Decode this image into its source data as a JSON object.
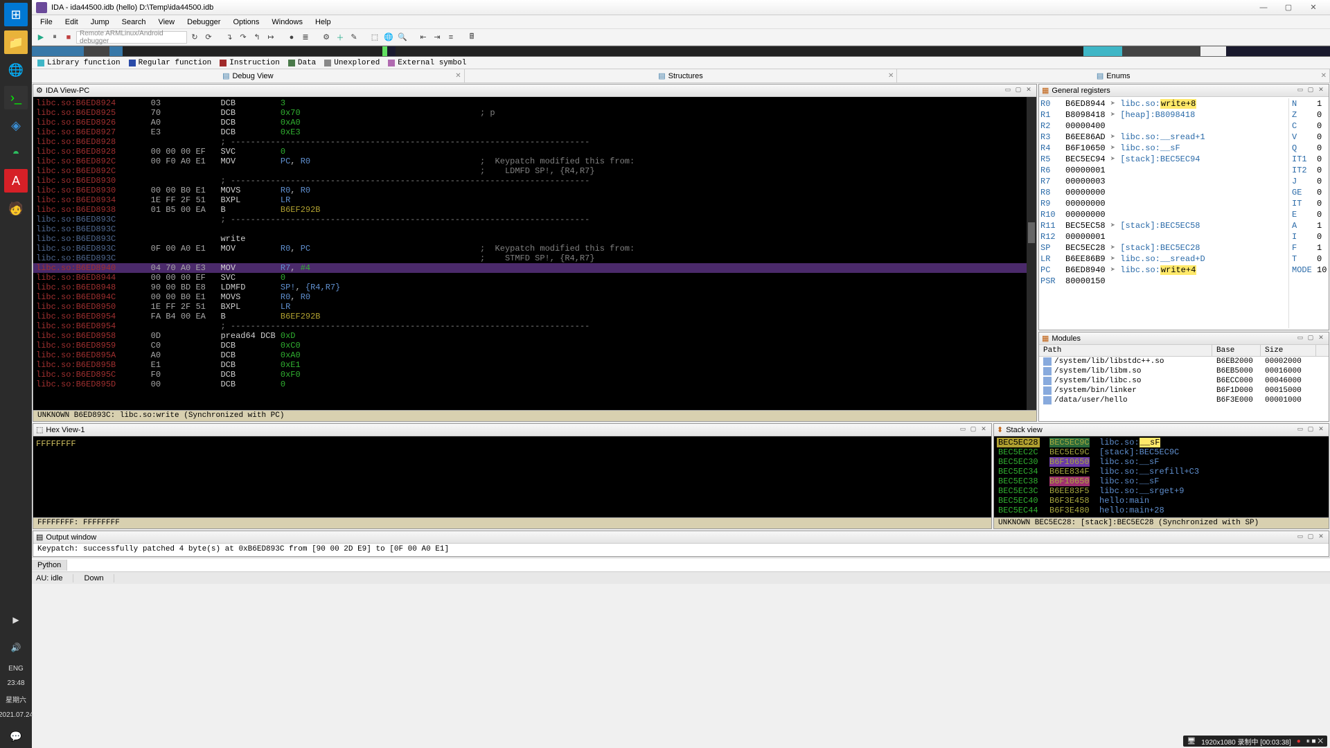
{
  "taskbar": {
    "lang": "ENG",
    "time": "23:48",
    "day": "星期六",
    "date": "2021.07.24"
  },
  "window": {
    "title": "IDA - ida44500.idb (hello)  D:\\Temp\\ida44500.idb"
  },
  "menu": [
    "File",
    "Edit",
    "Jump",
    "Search",
    "View",
    "Debugger",
    "Options",
    "Windows",
    "Help"
  ],
  "debugger_selector": "Remote ARMLinux/Android debugger",
  "legend": [
    {
      "color": "#3fb6c6",
      "label": "Library function"
    },
    {
      "color": "#2a4ba8",
      "label": "Regular function"
    },
    {
      "color": "#a02a2a",
      "label": "Instruction"
    },
    {
      "color": "#4a7a4a",
      "label": "Data"
    },
    {
      "color": "#888",
      "label": "Unexplored"
    },
    {
      "color": "#b06ab0",
      "label": "External symbol"
    }
  ],
  "top_tabs": [
    {
      "label": "Debug View",
      "closable": true
    },
    {
      "label": "Structures",
      "closable": true
    },
    {
      "label": "Enums",
      "closable": true
    }
  ],
  "panels": {
    "ida_view_title": "IDA View-PC",
    "regs_title": "General registers",
    "modules_title": "Modules",
    "hex_title": "Hex View-1",
    "stack_title": "Stack view",
    "output_title": "Output window"
  },
  "disasm": [
    {
      "loc": "libc.so:B6ED8924",
      "hex": "03",
      "mnem": "DCB",
      "ops": [
        {
          "t": "num",
          "v": "3"
        }
      ]
    },
    {
      "loc": "libc.so:B6ED8925",
      "hex": "70",
      "mnem": "DCB",
      "ops": [
        {
          "t": "num",
          "v": "0x70"
        }
      ],
      "cmt": "; p"
    },
    {
      "loc": "libc.so:B6ED8926",
      "hex": "A0",
      "mnem": "DCB",
      "ops": [
        {
          "t": "num",
          "v": "0xA0"
        }
      ]
    },
    {
      "loc": "libc.so:B6ED8927",
      "hex": "E3",
      "mnem": "DCB",
      "ops": [
        {
          "t": "num",
          "v": "0xE3"
        }
      ]
    },
    {
      "loc": "libc.so:B6ED8928",
      "hex": "",
      "mnem": ";",
      "dash": true
    },
    {
      "loc": "libc.so:B6ED8928",
      "hex": "00 00 00 EF",
      "mnem": "SVC",
      "ops": [
        {
          "t": "num",
          "v": "0"
        }
      ]
    },
    {
      "loc": "libc.so:B6ED892C",
      "hex": "00 F0 A0 E1",
      "mnem": "MOV",
      "ops": [
        {
          "t": "reg",
          "v": "PC"
        },
        {
          "t": "reg",
          "v": "R0"
        }
      ],
      "cmt": ";  Keypatch modified this from:"
    },
    {
      "loc": "libc.so:B6ED892C",
      "hex": "",
      "mnem": "",
      "cmt": ";    LDMFD SP!, {R4,R7}"
    },
    {
      "loc": "libc.so:B6ED8930",
      "hex": "",
      "mnem": ";",
      "dash": true
    },
    {
      "loc": "libc.so:B6ED8930",
      "hex": "00 00 B0 E1",
      "mnem": "MOVS",
      "ops": [
        {
          "t": "reg",
          "v": "R0"
        },
        {
          "t": "reg",
          "v": "R0"
        }
      ]
    },
    {
      "loc": "libc.so:B6ED8934",
      "hex": "1E FF 2F 51",
      "mnem": "BXPL",
      "ops": [
        {
          "t": "reg",
          "v": "LR"
        }
      ]
    },
    {
      "loc": "libc.so:B6ED8938",
      "hex": "01 B5 00 EA",
      "mnem": "B",
      "ops": [
        {
          "t": "addr",
          "v": "B6EF292B"
        }
      ]
    },
    {
      "loc": "libc.so:B6ED893C",
      "blue": true,
      "hex": "",
      "mnem": ";",
      "dash": true
    },
    {
      "loc": "libc.so:B6ED893C",
      "blue": true,
      "hex": "",
      "mnem": ""
    },
    {
      "loc": "libc.so:B6ED893C",
      "blue": true,
      "hex": "",
      "mnem": "write"
    },
    {
      "loc": "libc.so:B6ED893C",
      "blue": true,
      "hex": "0F 00 A0 E1",
      "mnem": "MOV",
      "ops": [
        {
          "t": "reg",
          "v": "R0"
        },
        {
          "t": "reg",
          "v": "PC"
        }
      ],
      "cmt": ";  Keypatch modified this from:"
    },
    {
      "loc": "libc.so:B6ED893C",
      "blue": true,
      "hex": "",
      "mnem": "",
      "cmt": ";    STMFD SP!, {R4,R7}"
    },
    {
      "loc": "libc.so:B6ED8940",
      "hex": "04 70 A0 E3",
      "mnem": "MOV",
      "ops": [
        {
          "t": "reg",
          "v": "R7"
        },
        {
          "t": "num",
          "v": "#4"
        }
      ],
      "hl": true
    },
    {
      "loc": "libc.so:B6ED8944",
      "hex": "00 00 00 EF",
      "mnem": "SVC",
      "ops": [
        {
          "t": "num",
          "v": "0"
        }
      ]
    },
    {
      "loc": "libc.so:B6ED8948",
      "hex": "90 00 BD E8",
      "mnem": "LDMFD",
      "ops": [
        {
          "t": "reg",
          "v": "SP!"
        },
        {
          "t": "reg",
          "v": "{R4,R7}"
        }
      ]
    },
    {
      "loc": "libc.so:B6ED894C",
      "hex": "00 00 B0 E1",
      "mnem": "MOVS",
      "ops": [
        {
          "t": "reg",
          "v": "R0"
        },
        {
          "t": "reg",
          "v": "R0"
        }
      ]
    },
    {
      "loc": "libc.so:B6ED8950",
      "hex": "1E FF 2F 51",
      "mnem": "BXPL",
      "ops": [
        {
          "t": "reg",
          "v": "LR"
        }
      ]
    },
    {
      "loc": "libc.so:B6ED8954",
      "hex": "FA B4 00 EA",
      "mnem": "B",
      "ops": [
        {
          "t": "addr",
          "v": "B6EF292B"
        }
      ]
    },
    {
      "loc": "libc.so:B6ED8954",
      "hex": "",
      "mnem": ";",
      "dash": true
    },
    {
      "loc": "libc.so:B6ED8958",
      "hex": "0D",
      "mnem": "pread64 DCB",
      "ops": [
        {
          "t": "num",
          "v": "0xD"
        }
      ]
    },
    {
      "loc": "libc.so:B6ED8959",
      "hex": "C0",
      "mnem": "DCB",
      "ops": [
        {
          "t": "num",
          "v": "0xC0"
        }
      ]
    },
    {
      "loc": "libc.so:B6ED895A",
      "hex": "A0",
      "mnem": "DCB",
      "ops": [
        {
          "t": "num",
          "v": "0xA0"
        }
      ]
    },
    {
      "loc": "libc.so:B6ED895B",
      "hex": "E1",
      "mnem": "DCB",
      "ops": [
        {
          "t": "num",
          "v": "0xE1"
        }
      ]
    },
    {
      "loc": "libc.so:B6ED895C",
      "hex": "F0",
      "mnem": "DCB",
      "ops": [
        {
          "t": "num",
          "v": "0xF0"
        }
      ]
    },
    {
      "loc": "libc.so:B6ED895D",
      "hex": "00",
      "mnem": "DCB",
      "ops": [
        {
          "t": "num",
          "v": "0"
        }
      ]
    }
  ],
  "disasm_status": "UNKNOWN B6ED893C: libc.so:write (Synchronized with PC)",
  "registers": [
    {
      "n": "R0",
      "v": "B6ED8944",
      "x": "libc.so:",
      "xy": "write+8"
    },
    {
      "n": "R1",
      "v": "B8098418",
      "x": "[heap]:B8098418",
      "hh": false
    },
    {
      "n": "R2",
      "v": "00000400"
    },
    {
      "n": "R3",
      "v": "B6EE86AD",
      "x": "libc.so:__sread+1"
    },
    {
      "n": "R4",
      "v": "B6F10650",
      "x": "libc.so:__sF"
    },
    {
      "n": "R5",
      "v": "BEC5EC94",
      "x": "[stack]:BEC5EC94"
    },
    {
      "n": "R6",
      "v": "00000001"
    },
    {
      "n": "R7",
      "v": "00000003"
    },
    {
      "n": "R8",
      "v": "00000000"
    },
    {
      "n": "R9",
      "v": "00000000"
    },
    {
      "n": "R10",
      "v": "00000000"
    },
    {
      "n": "R11",
      "v": "BEC5EC58",
      "x": "[stack]:BEC5EC58"
    },
    {
      "n": "R12",
      "v": "00000001"
    },
    {
      "n": "SP",
      "v": "BEC5EC28",
      "x": "[stack]:BEC5EC28"
    },
    {
      "n": "LR",
      "v": "B6EE86B9",
      "x": "libc.so:__sread+D"
    },
    {
      "n": "PC",
      "v": "B6ED8940",
      "x": "libc.so:",
      "xy": "write+4"
    },
    {
      "n": "PSR",
      "v": "80000150"
    }
  ],
  "flags": [
    {
      "n": "N",
      "v": "1"
    },
    {
      "n": "Z",
      "v": "0"
    },
    {
      "n": "C",
      "v": "0"
    },
    {
      "n": "V",
      "v": "0"
    },
    {
      "n": "Q",
      "v": "0"
    },
    {
      "n": "IT1",
      "v": "0"
    },
    {
      "n": "IT2",
      "v": "0"
    },
    {
      "n": "J",
      "v": "0"
    },
    {
      "n": "GE",
      "v": "0"
    },
    {
      "n": "IT",
      "v": "0"
    },
    {
      "n": "E",
      "v": "0"
    },
    {
      "n": "A",
      "v": "1"
    },
    {
      "n": "I",
      "v": "0"
    },
    {
      "n": "F",
      "v": "1"
    },
    {
      "n": "T",
      "v": "0"
    },
    {
      "n": "MODE",
      "v": "10"
    }
  ],
  "modules_cols": [
    "Path",
    "Base",
    "Size"
  ],
  "modules": [
    {
      "path": "/system/lib/libstdc++.so",
      "base": "B6EB2000",
      "size": "00002000"
    },
    {
      "path": "/system/lib/libm.so",
      "base": "B6EB5000",
      "size": "00016000"
    },
    {
      "path": "/system/lib/libc.so",
      "base": "B6ECC000",
      "size": "00046000"
    },
    {
      "path": "/system/bin/linker",
      "base": "B6F1D000",
      "size": "00015000"
    },
    {
      "path": "/data/user/hello",
      "base": "B6F3E000",
      "size": "00001000"
    }
  ],
  "hexview_text": "FFFFFFFF",
  "hexview_status": "FFFFFFFF: FFFFFFFF",
  "stack": [
    {
      "a": "BEC5EC28",
      "v": "BEC5EC9C",
      "xp": "libc.so:",
      "xy": "__sF",
      "vhl": "hlg",
      "ahl": true,
      "y": true
    },
    {
      "a": "BEC5EC2C",
      "v": "BEC5EC9C",
      "x": "[stack]:BEC5EC9C",
      "vhl": ""
    },
    {
      "a": "BEC5EC30",
      "v": "B6F10650",
      "x": "libc.so:__sF",
      "vhl": "hlp"
    },
    {
      "a": "BEC5EC34",
      "v": "B6EE834F",
      "x": "libc.so:__srefill+C3",
      "vhl": ""
    },
    {
      "a": "BEC5EC38",
      "v": "B6F10650",
      "x": "libc.so:__sF",
      "vhl": "hlp2"
    },
    {
      "a": "BEC5EC3C",
      "v": "B6EE83F5",
      "x": "libc.so:__srget+9",
      "vhl": ""
    },
    {
      "a": "BEC5EC40",
      "v": "B6F3E458",
      "x": "hello:main",
      "vhl": ""
    },
    {
      "a": "BEC5EC44",
      "v": "B6F3E480",
      "x": "hello:main+28",
      "vhl": ""
    }
  ],
  "stack_status": "UNKNOWN BEC5EC28: [stack]:BEC5EC28 (Synchronized with SP)",
  "output_line": "Keypatch: successfully patched 4 byte(s) at 0xB6ED893C from [90 00 2D E9] to [0F 00 A0 E1]",
  "cmd_label": "Python",
  "statusbar": {
    "au": "AU:",
    "idle": "idle",
    "down": "Down"
  },
  "recorder": "1920x1080   录制中 [00:03:38]"
}
